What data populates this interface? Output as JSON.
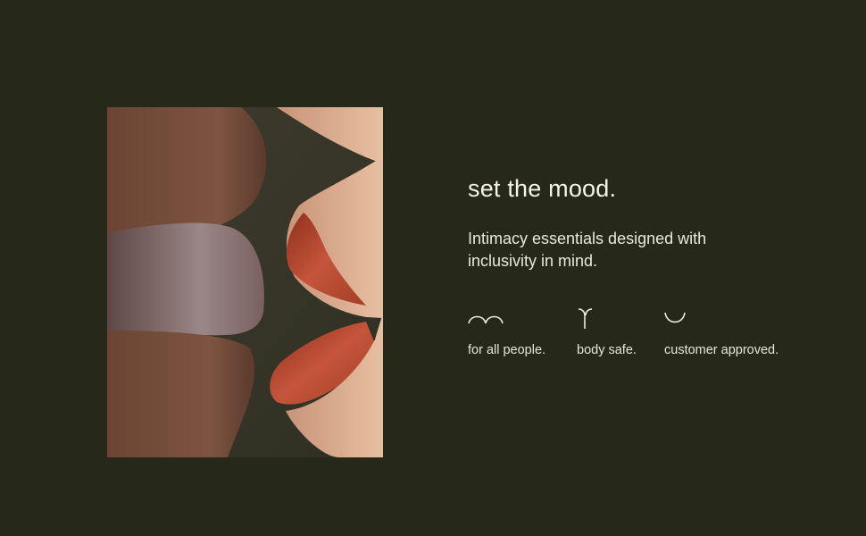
{
  "headline": "set the mood.",
  "subheadline": "Intimacy essentials designed with inclusivity in mind.",
  "features": [
    {
      "icon": "double-arch-icon",
      "label": "for all people."
    },
    {
      "icon": "y-stem-icon",
      "label": "body safe."
    },
    {
      "icon": "smile-curve-icon",
      "label": "customer approved."
    }
  ],
  "colors": {
    "background": "#262819",
    "text": "#f3f0e6",
    "lip_left": "#8a7a7b",
    "lip_right": "#b9472d"
  }
}
